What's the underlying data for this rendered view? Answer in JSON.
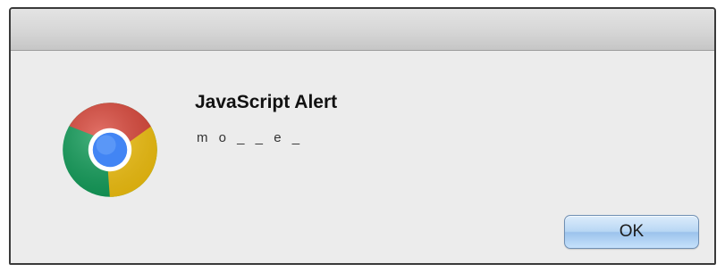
{
  "dialog": {
    "title": "JavaScript Alert",
    "message": "m o _ _ e _",
    "ok_label": "OK",
    "app_icon": "chrome-logo-icon"
  },
  "colors": {
    "chrome_red": "#db4437",
    "chrome_green": "#0f9d58",
    "chrome_yellow": "#f4c20d",
    "chrome_blue": "#4285f4",
    "ok_button_blue": "#b9d7f4"
  }
}
